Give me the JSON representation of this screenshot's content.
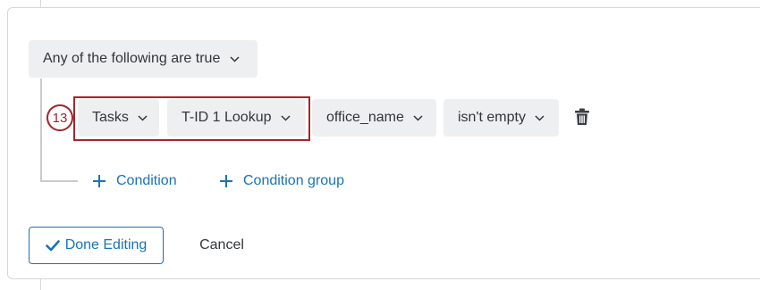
{
  "logic": {
    "group_selector": "Any of the following are true"
  },
  "condition": {
    "step_number": "13",
    "source": "Tasks",
    "lookup": "T-ID 1 Lookup",
    "field": "office_name",
    "operator": "isn't empty"
  },
  "actions": {
    "add_condition": "Condition",
    "add_condition_group": "Condition group"
  },
  "footer": {
    "done_label": "Done Editing",
    "cancel_label": "Cancel"
  },
  "colors": {
    "accent": "#1a73b8",
    "highlight": "#a5252b",
    "dropdown_bg": "#eeeff1"
  }
}
